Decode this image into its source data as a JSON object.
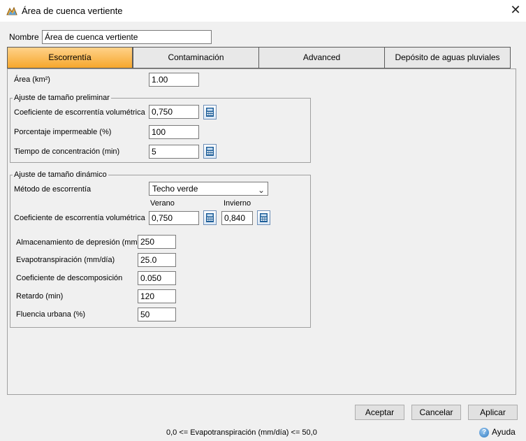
{
  "window": {
    "title": "Área de cuenca vertiente",
    "close_symbol": "✕",
    "app_icon": "catchment-icon"
  },
  "name_field": {
    "label": "Nombre",
    "value": "Área de cuenca vertiente"
  },
  "tabs": [
    {
      "label": "Escorrentía",
      "active": true
    },
    {
      "label": "Contaminación",
      "active": false
    },
    {
      "label": "Advanced",
      "active": false
    },
    {
      "label": "Depósito de aguas pluviales",
      "active": false
    }
  ],
  "area": {
    "label": "Área (km²)",
    "value": "1.00"
  },
  "preliminary": {
    "title": "Ajuste de tamaño preliminar",
    "runoff_coef": {
      "label": "Coeficiente de escorrentía volumétrica",
      "value": "0,750"
    },
    "impervious": {
      "label": "Porcentaje impermeable (%)",
      "value": "100"
    },
    "concentration": {
      "label": "Tiempo de concentración (min)",
      "value": "5"
    }
  },
  "dynamic": {
    "title": "Ajuste de tamaño dinámico",
    "method": {
      "label": "Método de escorrentía",
      "value": "Techo verde"
    },
    "summer_label": "Verano",
    "winter_label": "Invierno",
    "runoff_coef": {
      "label": "Coeficiente de escorrentía volumétrica",
      "summer": "0,750",
      "winter": "0,840"
    },
    "depression": {
      "label": "Almacenamiento de depresión (mm)",
      "value": "250"
    },
    "evapo": {
      "label": "Evapotranspiración (mm/día)",
      "value": "25.0"
    },
    "decay": {
      "label": "Coeficiente de descomposición",
      "value": "0.050"
    },
    "lag": {
      "label": "Retardo (min)",
      "value": "120"
    },
    "urban_creep": {
      "label": "Fluencia urbana (%)",
      "value": "50"
    }
  },
  "buttons": {
    "accept": "Aceptar",
    "cancel": "Cancelar",
    "apply": "Aplicar"
  },
  "status": "0,0 <= Evapotranspiración (mm/día) <= 50,0",
  "help": {
    "label": "Ayuda",
    "icon": "help-icon"
  },
  "colors": {
    "active_tab": "#f6a72c",
    "calculator": "#1f5f99"
  }
}
